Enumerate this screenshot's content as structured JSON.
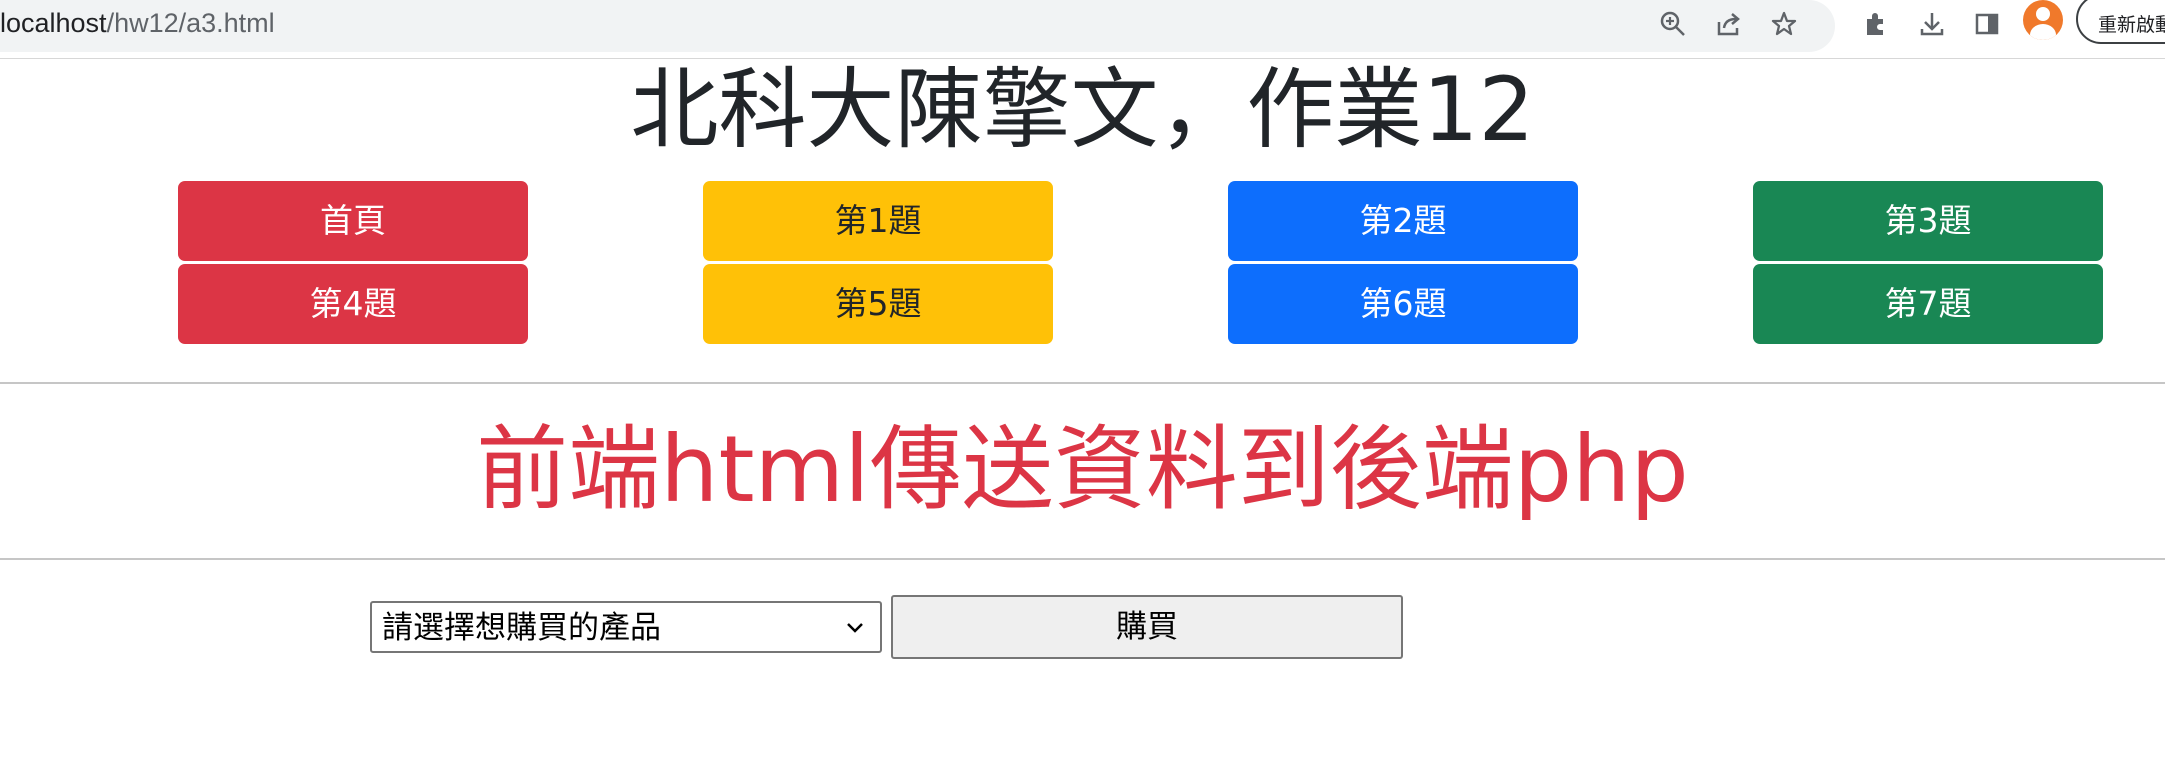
{
  "browser": {
    "url_host": "localhost",
    "url_path": "/hw12/a3.html",
    "relaunch_label": "重新啟動"
  },
  "header": {
    "title": "北科大陳擎文，作業12"
  },
  "nav": {
    "buttons": [
      {
        "label": "首頁",
        "color": "#dc3545"
      },
      {
        "label": "第1題",
        "color": "#ffc107"
      },
      {
        "label": "第2題",
        "color": "#0d6efd"
      },
      {
        "label": "第3題",
        "color": "#198754"
      },
      {
        "label": "第4題",
        "color": "#dc3545"
      },
      {
        "label": "第5題",
        "color": "#ffc107"
      },
      {
        "label": "第6題",
        "color": "#0d6efd"
      },
      {
        "label": "第7題",
        "color": "#198754"
      }
    ]
  },
  "main": {
    "subtitle": "前端html傳送資料到後端php",
    "subtitle_color": "#dc3545",
    "product_select_value": "請選擇想購買的產品",
    "buy_label": "購買"
  }
}
